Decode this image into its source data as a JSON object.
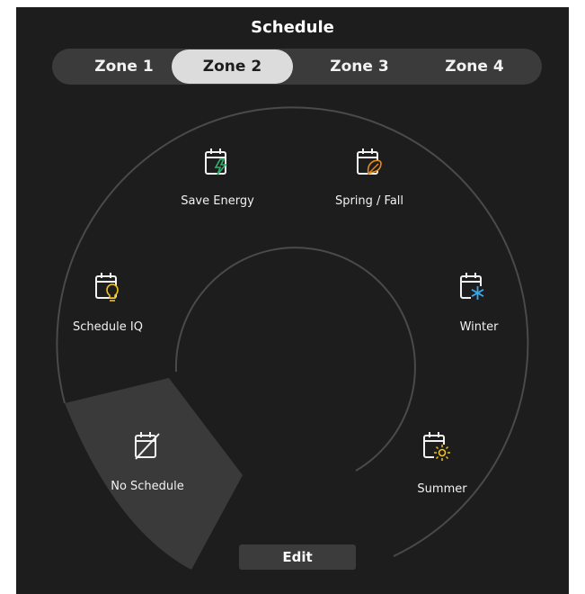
{
  "header": {
    "title": "Schedule"
  },
  "tabs": [
    {
      "label": "Zone 1"
    },
    {
      "label": "Zone 2"
    },
    {
      "label": "Zone 3"
    },
    {
      "label": "Zone 4"
    }
  ],
  "active_tab": "Zone 2",
  "segments": [
    {
      "label": "Save Energy",
      "icon": "calendar-lightning-icon",
      "accent": "#2fb36a"
    },
    {
      "label": "Spring / Fall",
      "icon": "calendar-leaf-icon",
      "accent": "#e58a1f"
    },
    {
      "label": "Schedule IQ",
      "icon": "calendar-lightbulb-icon",
      "accent": "#f2c21b"
    },
    {
      "label": "Winter",
      "icon": "calendar-snowflake-icon",
      "accent": "#3aa7e6"
    },
    {
      "label": "No Schedule",
      "icon": "calendar-crossed-icon",
      "accent": "#f2f2f2"
    },
    {
      "label": "Summer",
      "icon": "calendar-sun-icon",
      "accent": "#f2c21b"
    }
  ],
  "selected_segment": "No Schedule",
  "actions": {
    "edit_label": "Edit"
  },
  "colors": {
    "background": "#1d1d1d",
    "tab_bar": "#3b3b3b",
    "tab_active": "#dcdcdc",
    "ring": "#4a4a4a",
    "selected_segment": "#3a3a3a"
  }
}
